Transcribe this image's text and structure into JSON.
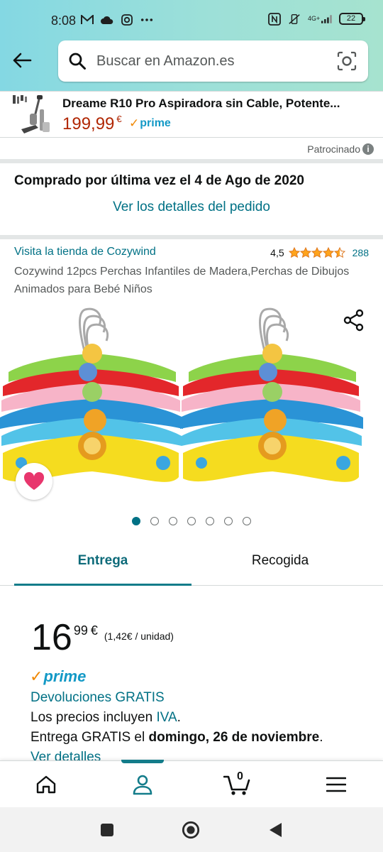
{
  "status_bar": {
    "time": "8:08",
    "network": "4G+",
    "battery": "22"
  },
  "search": {
    "placeholder": "Buscar en Amazon.es"
  },
  "sponsored": {
    "title": "Dreame R10 Pro Aspiradora sin Cable, Potente...",
    "price": "199,99",
    "currency": "€",
    "prime": "prime",
    "label": "Patrocinado"
  },
  "purchase": {
    "last_bought": "Comprado por última vez el 4 de Ago de 2020",
    "order_link": "Ver los detalles del pedido"
  },
  "product": {
    "store_link": "Visita la tienda de Cozywind",
    "rating": "4,5",
    "rating_value": 4.5,
    "review_count": "288",
    "title": "Cozywind 12pcs Perchas Infantiles de Madera,Perchas de Dibujos Animados para Bebé Niños",
    "image_count": 7,
    "image_index": 1
  },
  "tabs": [
    {
      "label": "Entrega",
      "active": true
    },
    {
      "label": "Recogida",
      "active": false
    }
  ],
  "price": {
    "whole": "16",
    "cents": "99",
    "currency": "€",
    "unit": "(1,42€ / unidad)"
  },
  "delivery": {
    "prime": "prime",
    "returns": "Devoluciones GRATIS",
    "tax_prefix": "Los precios incluyen ",
    "tax_link": "IVA",
    "tax_suffix": ".",
    "delivery_prefix": "Entrega GRATIS el ",
    "delivery_date": "domingo, 26 de noviembre",
    "delivery_suffix": ".",
    "details_link": "Ver detalles"
  },
  "bottom_nav": {
    "cart_count": "0",
    "active": "account"
  },
  "colors": {
    "header_gradient_start": "#84d8e3",
    "header_gradient_end": "#a6e3cf",
    "link": "#007185",
    "price_red": "#b12704",
    "prime_blue": "#1399c6",
    "prime_check": "#f08804",
    "star": "#ffa41c",
    "tab_accent": "#137c8a"
  },
  "icons": {
    "back": "back-arrow-icon",
    "search": "search-icon",
    "camera": "camera-lens-icon",
    "share": "share-icon",
    "wishlist": "heart-icon",
    "home": "home-icon",
    "account": "account-icon",
    "cart": "cart-icon",
    "menu": "hamburger-menu-icon"
  }
}
